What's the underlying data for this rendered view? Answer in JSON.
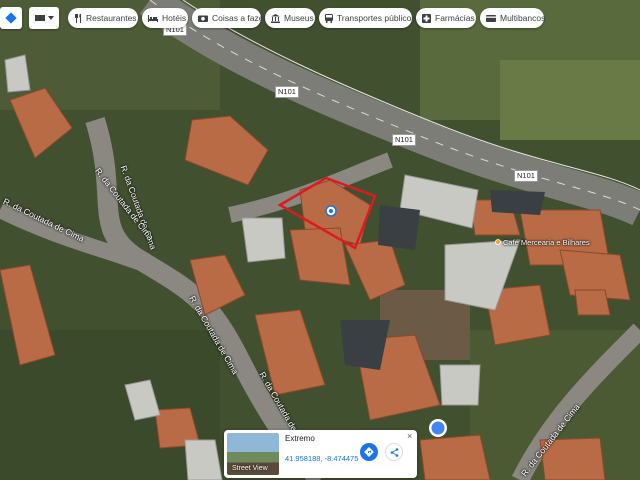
{
  "toolbar": {
    "categories": [
      {
        "label": "Restaurantes",
        "icon": "restaurant-icon"
      },
      {
        "label": "Hotéis",
        "icon": "hotel-icon"
      },
      {
        "label": "Coisas a fazer",
        "icon": "camera-icon"
      },
      {
        "label": "Museus",
        "icon": "museum-icon"
      },
      {
        "label": "Transportes públicos",
        "icon": "transit-icon"
      },
      {
        "label": "Farmácias",
        "icon": "pharmacy-icon"
      },
      {
        "label": "Multibancos",
        "icon": "atm-icon"
      }
    ],
    "layer_icon": "layers-icon",
    "dropdown_icon": "chevron-down-icon"
  },
  "map": {
    "road_labels": [
      "N101",
      "N101",
      "N101",
      "N101"
    ],
    "street_labels": [
      "R. da Coutada de Cima",
      "R. da Coutada de Cima",
      "R. da Coutada de Cima",
      "R. da Coutada de Cima",
      "R. da Coutada de Cima",
      "R. da Coutada de Cima"
    ],
    "poi": "Café Mercearia e Bilhares",
    "highlight_color": "#e0191e"
  },
  "place_card": {
    "title": "Extremo",
    "coords": "41.958188, -8.474475",
    "street_view_label": "Street View",
    "close": "×"
  }
}
